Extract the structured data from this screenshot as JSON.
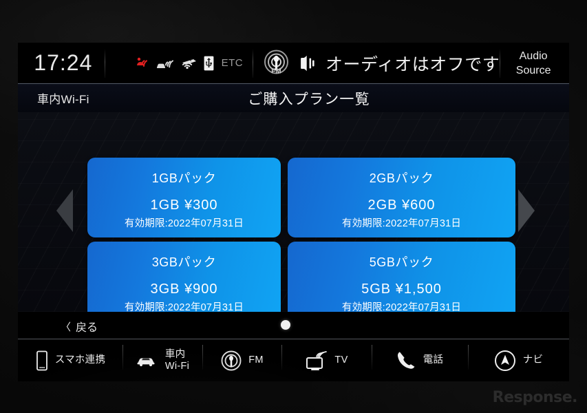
{
  "status_bar": {
    "clock": "17:24",
    "icons": [
      {
        "name": "gps-alert-icon",
        "color": "#e02020"
      },
      {
        "name": "car-signal-icon",
        "color": "#e6e6e6"
      },
      {
        "name": "wifi-hotspot-icon",
        "color": "#e6e6e6"
      },
      {
        "name": "usb-icon",
        "color": "#e6e6e6"
      }
    ],
    "etc_label": "ETC",
    "source_icon": "fm-radio-icon",
    "mute_icon": "speaker-icon",
    "audio_message": "オーディオはオフです",
    "audio_source_line1": "Audio",
    "audio_source_line2": "Source"
  },
  "title_bar": {
    "subtitle_left": "車内Wi-Fi",
    "title": "ご購入プラン一覧"
  },
  "content": {
    "prev_arrow_label": "◀",
    "next_arrow_label": "▶",
    "plans": [
      {
        "name": "1GBパック",
        "price": "1GB  ¥300",
        "expiry": "有効期限:2022年07月31日"
      },
      {
        "name": "2GBパック",
        "price": "2GB  ¥600",
        "expiry": "有効期限:2022年07月31日"
      },
      {
        "name": "3GBパック",
        "price": "3GB  ¥900",
        "expiry": "有効期限:2022年07月31日"
      },
      {
        "name": "5GBパック",
        "price": "5GB  ¥1,500",
        "expiry": "有効期限:2022年07月31日"
      }
    ],
    "back_chevron": "〈",
    "back_label": "戻る",
    "page_dots": 1,
    "current_page": 1
  },
  "bottom_nav": [
    {
      "icon": "smartphone-icon",
      "label": "スマホ連携"
    },
    {
      "icon": "car-icon",
      "label": "車内\nWi-Fi"
    },
    {
      "icon": "fm-antenna-icon",
      "label": "FM"
    },
    {
      "icon": "tv-icon",
      "label": "TV"
    },
    {
      "icon": "phone-icon",
      "label": "電話"
    },
    {
      "icon": "navigation-icon",
      "label": "ナビ"
    }
  ],
  "watermark": "Response.",
  "colors": {
    "card_blue_dark": "#1568cf",
    "card_blue_light": "#10a4f4",
    "alert_red": "#e02020",
    "text_primary": "#f2f2f2"
  }
}
